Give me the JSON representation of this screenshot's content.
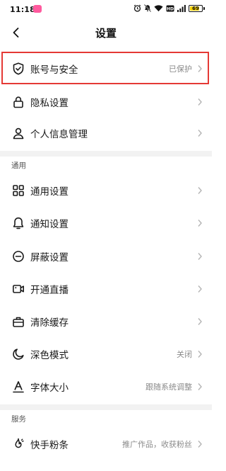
{
  "status_bar": {
    "time": "11:18",
    "battery": "69"
  },
  "header": {
    "title": "设置"
  },
  "account_section": [
    {
      "name": "account-security",
      "label": "账号与安全",
      "value": "已保护",
      "icon": "shield-check-icon"
    },
    {
      "name": "privacy-settings",
      "label": "隐私设置",
      "value": "",
      "icon": "lock-icon"
    },
    {
      "name": "personal-info",
      "label": "个人信息管理",
      "value": "",
      "icon": "person-icon"
    }
  ],
  "general_section": {
    "header": "通用",
    "items": [
      {
        "name": "general-settings",
        "label": "通用设置",
        "value": "",
        "icon": "grid-icon"
      },
      {
        "name": "notification-settings",
        "label": "通知设置",
        "value": "",
        "icon": "bell-icon"
      },
      {
        "name": "block-settings",
        "label": "屏蔽设置",
        "value": "",
        "icon": "block-icon"
      },
      {
        "name": "start-live",
        "label": "开通直播",
        "value": "",
        "icon": "video-camera-icon"
      },
      {
        "name": "clear-cache",
        "label": "清除缓存",
        "value": "",
        "icon": "briefcase-icon"
      },
      {
        "name": "dark-mode",
        "label": "深色模式",
        "value": "关闭",
        "icon": "moon-icon"
      },
      {
        "name": "font-size",
        "label": "字体大小",
        "value": "跟随系统调整",
        "icon": "text-a-icon"
      }
    ]
  },
  "service_section": {
    "header": "服务",
    "items": [
      {
        "name": "kuaishou-fans",
        "label": "快手粉条",
        "value": "推广作品，收获粉丝",
        "icon": "fire-icon"
      }
    ]
  }
}
